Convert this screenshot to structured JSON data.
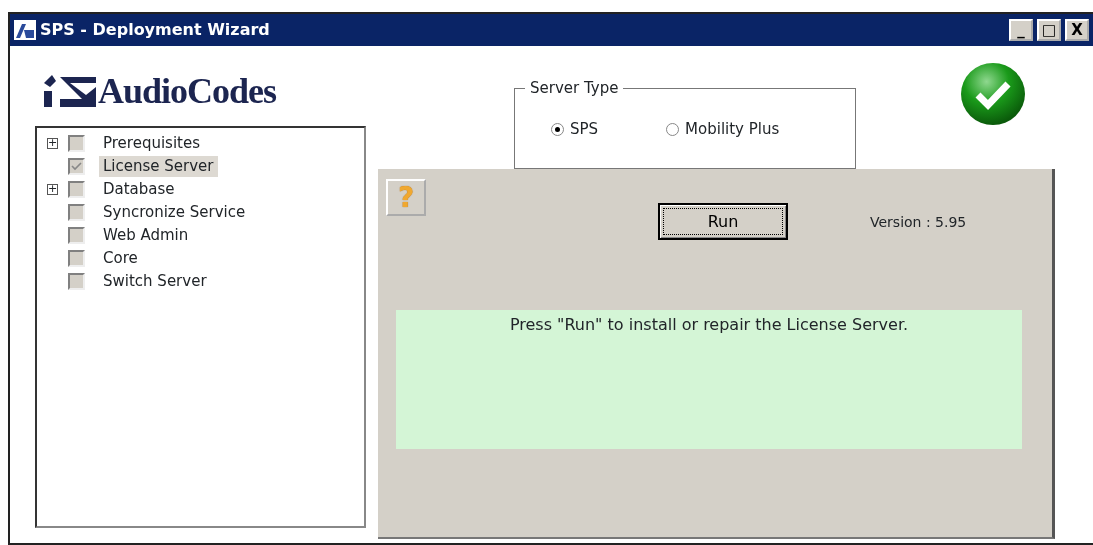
{
  "window": {
    "title": "SPS - Deployment Wizard",
    "controls": [
      "_",
      "□",
      "X"
    ]
  },
  "logo": {
    "text": "AudioCodes"
  },
  "tree": [
    {
      "label": "Prerequisites",
      "expander": "+",
      "checked": false,
      "selected": false
    },
    {
      "label": "License Server",
      "checked": true,
      "selected": true
    },
    {
      "label": "Database",
      "expander": "+",
      "checked": false,
      "selected": false
    },
    {
      "label": "Syncronize Service",
      "checked": false,
      "selected": false
    },
    {
      "label": "Web Admin",
      "checked": false,
      "selected": false
    },
    {
      "label": "Core",
      "checked": false,
      "selected": false
    },
    {
      "label": "Switch Server",
      "checked": false,
      "selected": false
    }
  ],
  "server_type": {
    "legend": "Server Type",
    "options": [
      {
        "label": "SPS",
        "selected": true
      },
      {
        "label": "Mobility Plus",
        "selected": false
      }
    ]
  },
  "status": {
    "ok": true
  },
  "panel": {
    "help": "?",
    "run": "Run",
    "version": "Version : 5.95",
    "message": "Press \"Run\" to install or repair the License Server."
  }
}
